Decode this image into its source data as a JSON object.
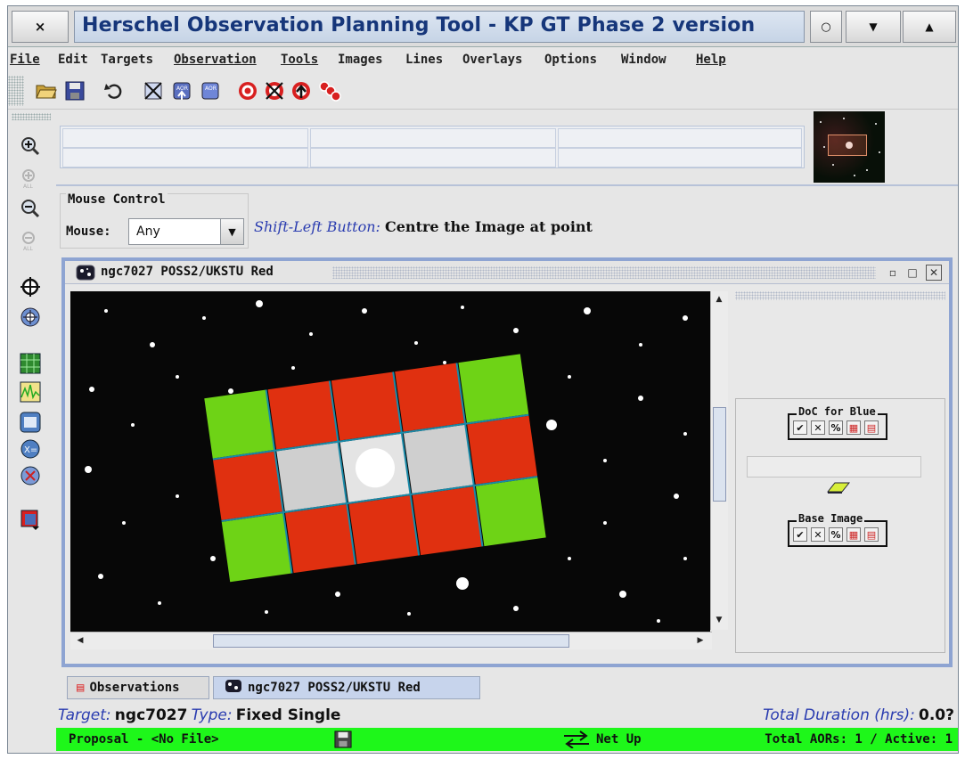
{
  "window": {
    "title": "Herschel Observation Planning Tool - KP GT Phase 2 version",
    "close_glyph": "×",
    "iconify_glyph": "○",
    "shade_glyph": "▼",
    "maximize_glyph": "▲"
  },
  "menu": [
    {
      "label": "File"
    },
    {
      "label": "Edit"
    },
    {
      "label": "Targets"
    },
    {
      "label": "Observation"
    },
    {
      "label": "Tools"
    },
    {
      "label": "Images"
    },
    {
      "label": "Lines"
    },
    {
      "label": "Overlays"
    },
    {
      "label": "Options"
    },
    {
      "label": "Window"
    },
    {
      "label": "Help"
    }
  ],
  "toolbar": {
    "icons": [
      "open-folder-icon",
      "save-icon",
      "undo-icon",
      "delete-aor-icon",
      "import-aor-icon",
      "aor-icon",
      "target-icon",
      "delete-target-icon",
      "target-up-icon",
      "targets-group-icon"
    ]
  },
  "mouse_control": {
    "legend": "Mouse Control",
    "label": "Mouse:",
    "value": "Any",
    "hint_key": "Shift-Left Button:",
    "hint_text": "Centre the Image at point"
  },
  "image_frame": {
    "title": "ngc7027  POSS2/UKSTU Red"
  },
  "side_panel": {
    "doc_for_blue": "DoC for Blue",
    "base_image": "Base Image",
    "mini_buttons": [
      "✔",
      "✕",
      "%",
      "▦",
      "▤"
    ]
  },
  "tabs": [
    {
      "label": "Observations",
      "active": false
    },
    {
      "label": "ngc7027  POSS2/UKSTU Red",
      "active": true
    }
  ],
  "status": {
    "target_key": "Target:",
    "target_val": "ngc7027",
    "type_key": "Type:",
    "type_val": "Fixed Single",
    "duration_key": "Total Duration (hrs):",
    "duration_val": "0.0?"
  },
  "green_bar": {
    "proposal": "Proposal - <No File>",
    "net": "Net Up",
    "aors": "Total AORs: 1  /  Active:  1"
  }
}
